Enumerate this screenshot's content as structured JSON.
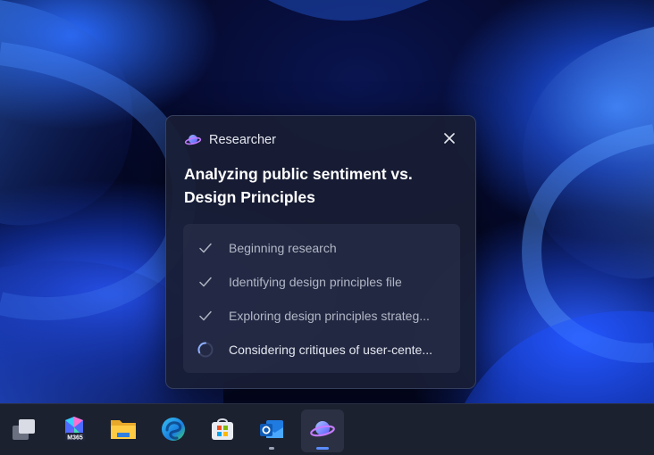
{
  "researcher": {
    "app_name": "Researcher",
    "title": "Analyzing public sentiment vs. Design Principles",
    "title_line1": "Analyzing public sentiment vs.",
    "title_line2": "Design Principles",
    "close_icon": "close-icon",
    "steps": [
      {
        "label": "Beginning research",
        "status": "done",
        "icon": "checkmark-icon"
      },
      {
        "label": "Identifying design principles file",
        "status": "done",
        "icon": "checkmark-icon"
      },
      {
        "label": "Exploring design principles strateg...",
        "status": "done",
        "icon": "checkmark-icon"
      },
      {
        "label": "Considering critiques of user-cente...",
        "status": "in-progress",
        "icon": "spinner-icon"
      }
    ]
  },
  "taskbar": {
    "apps": [
      {
        "name": "Task View",
        "icon": "task-view-icon"
      },
      {
        "name": "Microsoft 365",
        "icon": "m365-icon",
        "badge": "M365"
      },
      {
        "name": "File Explorer",
        "icon": "file-explorer-icon"
      },
      {
        "name": "Microsoft Edge",
        "icon": "edge-icon"
      },
      {
        "name": "Microsoft Store",
        "icon": "store-icon"
      },
      {
        "name": "Outlook",
        "icon": "outlook-icon"
      },
      {
        "name": "Researcher",
        "icon": "researcher-icon",
        "active": true
      }
    ]
  },
  "colors": {
    "accent": "#5b8cff",
    "panel_bg": "#181e34",
    "wallpaper": "#0a1550"
  }
}
